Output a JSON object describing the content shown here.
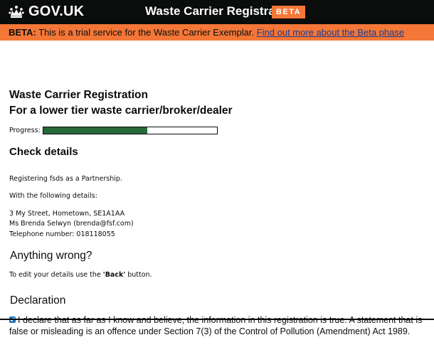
{
  "header": {
    "logo_text": "GOV.UK",
    "service_name": "Waste Carrier Registration",
    "phase_tag": "BETA"
  },
  "banner": {
    "label": "BETA:",
    "text": " This is a trial service for the Waste Carrier Exemplar. ",
    "link": "Find out more about the Beta phase"
  },
  "page": {
    "title": "Waste Carrier Registration",
    "subtitle": "For a lower tier waste carrier/broker/dealer",
    "progress_label": "Progress:",
    "progress_fraction": 0.6
  },
  "check": {
    "heading": "Check details",
    "registering": "Registering fsds as a Partnership.",
    "following": "With the following details:",
    "address": "3 My Street, Hometown, SE1A1AA",
    "contact": "Ms Brenda Selwyn (brenda@fsf.com)",
    "telephone": "Telephone number: 018118055"
  },
  "wrong": {
    "heading": "Anything wrong?",
    "prefix": "To edit your details use the ",
    "back_label": "'Back'",
    "suffix": " button."
  },
  "declaration": {
    "heading": "Declaration",
    "checked": true,
    "text": "I declare that as far as I know and believe, the information in this registration is true. A statement that is false or misleading is an offence under Section 7(3) of the Control of Pollution (Amendment) Act 1989."
  },
  "colors": {
    "header_bg": "#0b0c0c",
    "beta_orange": "#f47738",
    "progress_green": "#28683a",
    "link_blue": "#1d3a8a"
  }
}
